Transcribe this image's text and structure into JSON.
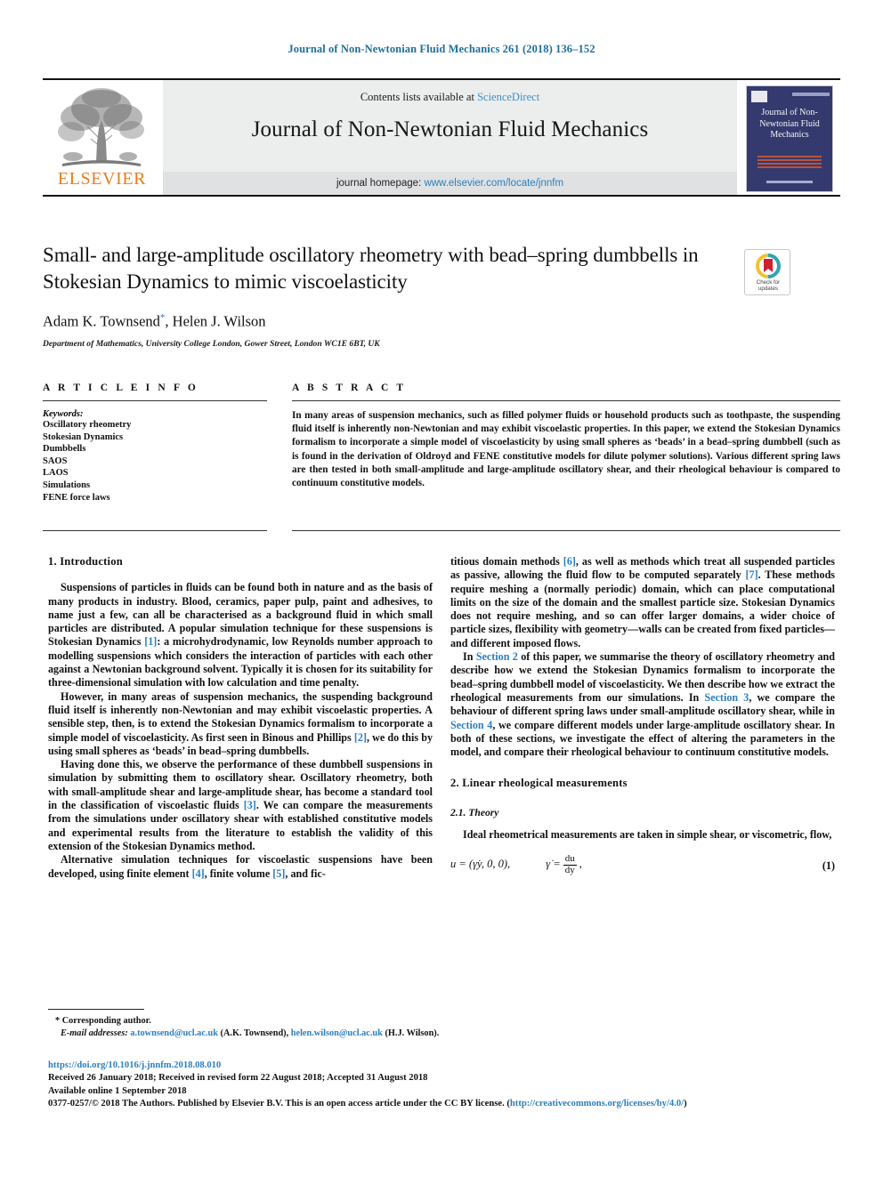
{
  "running_head": "Journal of Non-Newtonian Fluid Mechanics 261 (2018) 136–152",
  "masthead": {
    "contents_prefix": "Contents lists available at ",
    "sciencedirect": "ScienceDirect",
    "journal_title": "Journal of Non-Newtonian Fluid Mechanics",
    "homepage_prefix": "journal homepage: ",
    "homepage_url": "www.elsevier.com/locate/jnnfm",
    "publisher_wordmark": "ELSEVIER",
    "cover_title": "Journal of Non-Newtonian Fluid Mechanics"
  },
  "badge": {
    "line1": "Check for",
    "line2": "updates"
  },
  "title_block": {
    "title": "Small- and large-amplitude oscillatory rheometry with bead–spring dumbbells in Stokesian Dynamics to mimic viscoelasticity",
    "authors": "Adam K. Townsend",
    "authors_tail": ", Helen J. Wilson",
    "corresponding_marker": "*",
    "affiliation": "Department of Mathematics, University College London, Gower Street, London WC1E 6BT, UK"
  },
  "article_info": {
    "heading": "A R T I C L E   I N F O",
    "keywords_label": "Keywords:",
    "keywords": [
      "Oscillatory rheometry",
      "Stokesian Dynamics",
      "Dumbbells",
      "SAOS",
      "LAOS",
      "Simulations",
      "FENE force laws"
    ]
  },
  "abstract": {
    "heading": "A B S T R A C T",
    "text": "In many areas of suspension mechanics, such as filled polymer fluids or household products such as toothpaste, the suspending fluid itself is inherently non-Newtonian and may exhibit viscoelastic properties. In this paper, we extend the Stokesian Dynamics formalism to incorporate a simple model of viscoelasticity by using small spheres as ‘beads’ in a bead–spring dumbbell (such as is found in the derivation of Oldroyd and FENE constitutive models for dilute polymer solutions). Various different spring laws are then tested in both small-amplitude and large-amplitude oscillatory shear, and their rheological behaviour is compared to continuum constitutive models."
  },
  "body": {
    "section1_heading": "1. Introduction",
    "p1_a": "Suspensions of particles in fluids can be found both in nature and as the basis of many products in industry. Blood, ceramics, paper pulp, paint and adhesives, to name just a few, can all be characterised as a background fluid in which small particles are distributed. A popular simulation technique for these suspensions is Stokesian Dynamics ",
    "ref1": "[1]",
    "p1_b": ": a microhydrodynamic, low Reynolds number approach to modelling suspensions which considers the interaction of particles with each other against a Newtonian background solvent. Typically it is chosen for its suitability for three-dimensional simulation with low calculation and time penalty.",
    "p2_a": "However, in many areas of suspension mechanics, the suspending background fluid itself is inherently non-Newtonian and may exhibit viscoelastic properties. A sensible step, then, is to extend the Stokesian Dynamics formalism to incorporate a simple model of viscoelasticity. As first seen in Binous and Phillips ",
    "ref2": "[2]",
    "p2_b": ", we do this by using small spheres as ‘beads’ in bead–spring dumbbells.",
    "p3_a": "Having done this, we observe the performance of these dumbbell suspensions in simulation by submitting them to oscillatory shear. Oscillatory rheometry, both with small-amplitude shear and large-amplitude shear, has become a standard tool in the classification of viscoelastic fluids ",
    "ref3": "[3]",
    "p3_b": ". We can compare the measurements from the simulations under oscillatory shear with established constitutive models and experimental results from the literature to establish the validity of this extension of the Stokesian Dynamics method.",
    "p4_a": "Alternative simulation techniques for viscoelastic suspensions have been developed, using finite element ",
    "ref4": "[4]",
    "p4_b": ", finite volume ",
    "ref5": "[5]",
    "p4_c": ", and fic-",
    "p5_a": "titious domain methods ",
    "ref6": "[6]",
    "p5_b": ", as well as methods which treat all suspended particles as passive, allowing the fluid flow to be computed separately ",
    "ref7": "[7]",
    "p5_c": ". These methods require meshing a (normally periodic) domain, which can place computational limits on the size of the domain and the smallest particle size. Stokesian Dynamics does not require meshing, and so can offer larger domains, a wider choice of particle sizes, flexibility with geometry—walls can be created from fixed particles—and different imposed flows.",
    "p6_a": "In ",
    "link_section2": "Section 2",
    "p6_b": " of this paper, we summarise the theory of oscillatory rheometry and describe how we extend the Stokesian Dynamics formalism to incorporate the bead–spring dumbbell model of viscoelasticity. We then describe how we extract the rheological measurements from our simulations. In ",
    "link_section3": "Section 3",
    "p6_c": ", we compare the behaviour of different spring laws under small-amplitude oscillatory shear, while in ",
    "link_section4": "Section 4",
    "p6_d": ", we compare different models under large-amplitude oscillatory shear. In both of these sections, we investigate the effect of altering the parameters in the model, and compare their rheological behaviour to continuum constitutive models.",
    "section2_heading": "2. Linear rheological measurements",
    "subsection21_heading": "2.1. Theory",
    "p7": "Ideal rheometrical measurements are taken in simple shear, or viscometric, flow,",
    "equation1": {
      "lhs": "u = (γ̇y, 0, 0),",
      "rhs_var": "γ̇ =",
      "frac_num": "du",
      "frac_den": "dy",
      "tail": ",",
      "number": "(1)"
    }
  },
  "footer": {
    "corresponding": "* Corresponding author.",
    "emails_label": "E-mail addresses:",
    "email1": "a.townsend@ucl.ac.uk",
    "email1_owner": " (A.K. Townsend), ",
    "email2": "helen.wilson@ucl.ac.uk",
    "email2_owner": " (H.J. Wilson).",
    "doi": "https://doi.org/10.1016/j.jnnfm.2018.08.010",
    "received": "Received 26 January 2018; Received in revised form 22 August 2018; Accepted 31 August 2018",
    "available": "Available online 1 September 2018",
    "copyright_a": "0377-0257/© 2018 The Authors. Published by Elsevier B.V. This is an open access article under the CC BY license. (",
    "license_url": "http://creativecommons.org/licenses/by/4.0/",
    "copyright_b": ")"
  },
  "colors": {
    "link": "#2a7fc0",
    "running_head": "#1f6f9a",
    "elsevier_orange": "#e87d1e",
    "cover_navy": "#343a6e"
  }
}
